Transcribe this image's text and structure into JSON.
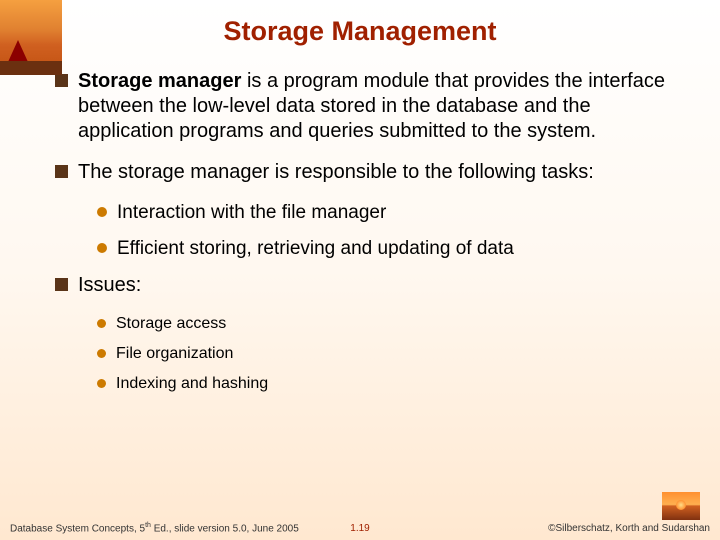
{
  "title": "Storage Management",
  "bullets": [
    {
      "bold_lead": "Storage manager",
      "rest": " is a program module that provides the interface between the low-level data stored in the database and the application programs and queries submitted to the system."
    },
    {
      "text": "The storage manager is responsible to the following tasks:",
      "subs": [
        "Interaction with the file manager",
        "Efficient storing, retrieving and updating of data"
      ]
    },
    {
      "text": "Issues:",
      "subs_small": [
        "Storage access",
        "File organization",
        "Indexing and hashing"
      ]
    }
  ],
  "footer": {
    "left_pre": "Database System Concepts, 5",
    "left_sup": "th",
    "left_post": " Ed., slide version 5.0, June 2005",
    "center": "1.19",
    "right": "©Silberschatz, Korth and Sudarshan"
  }
}
